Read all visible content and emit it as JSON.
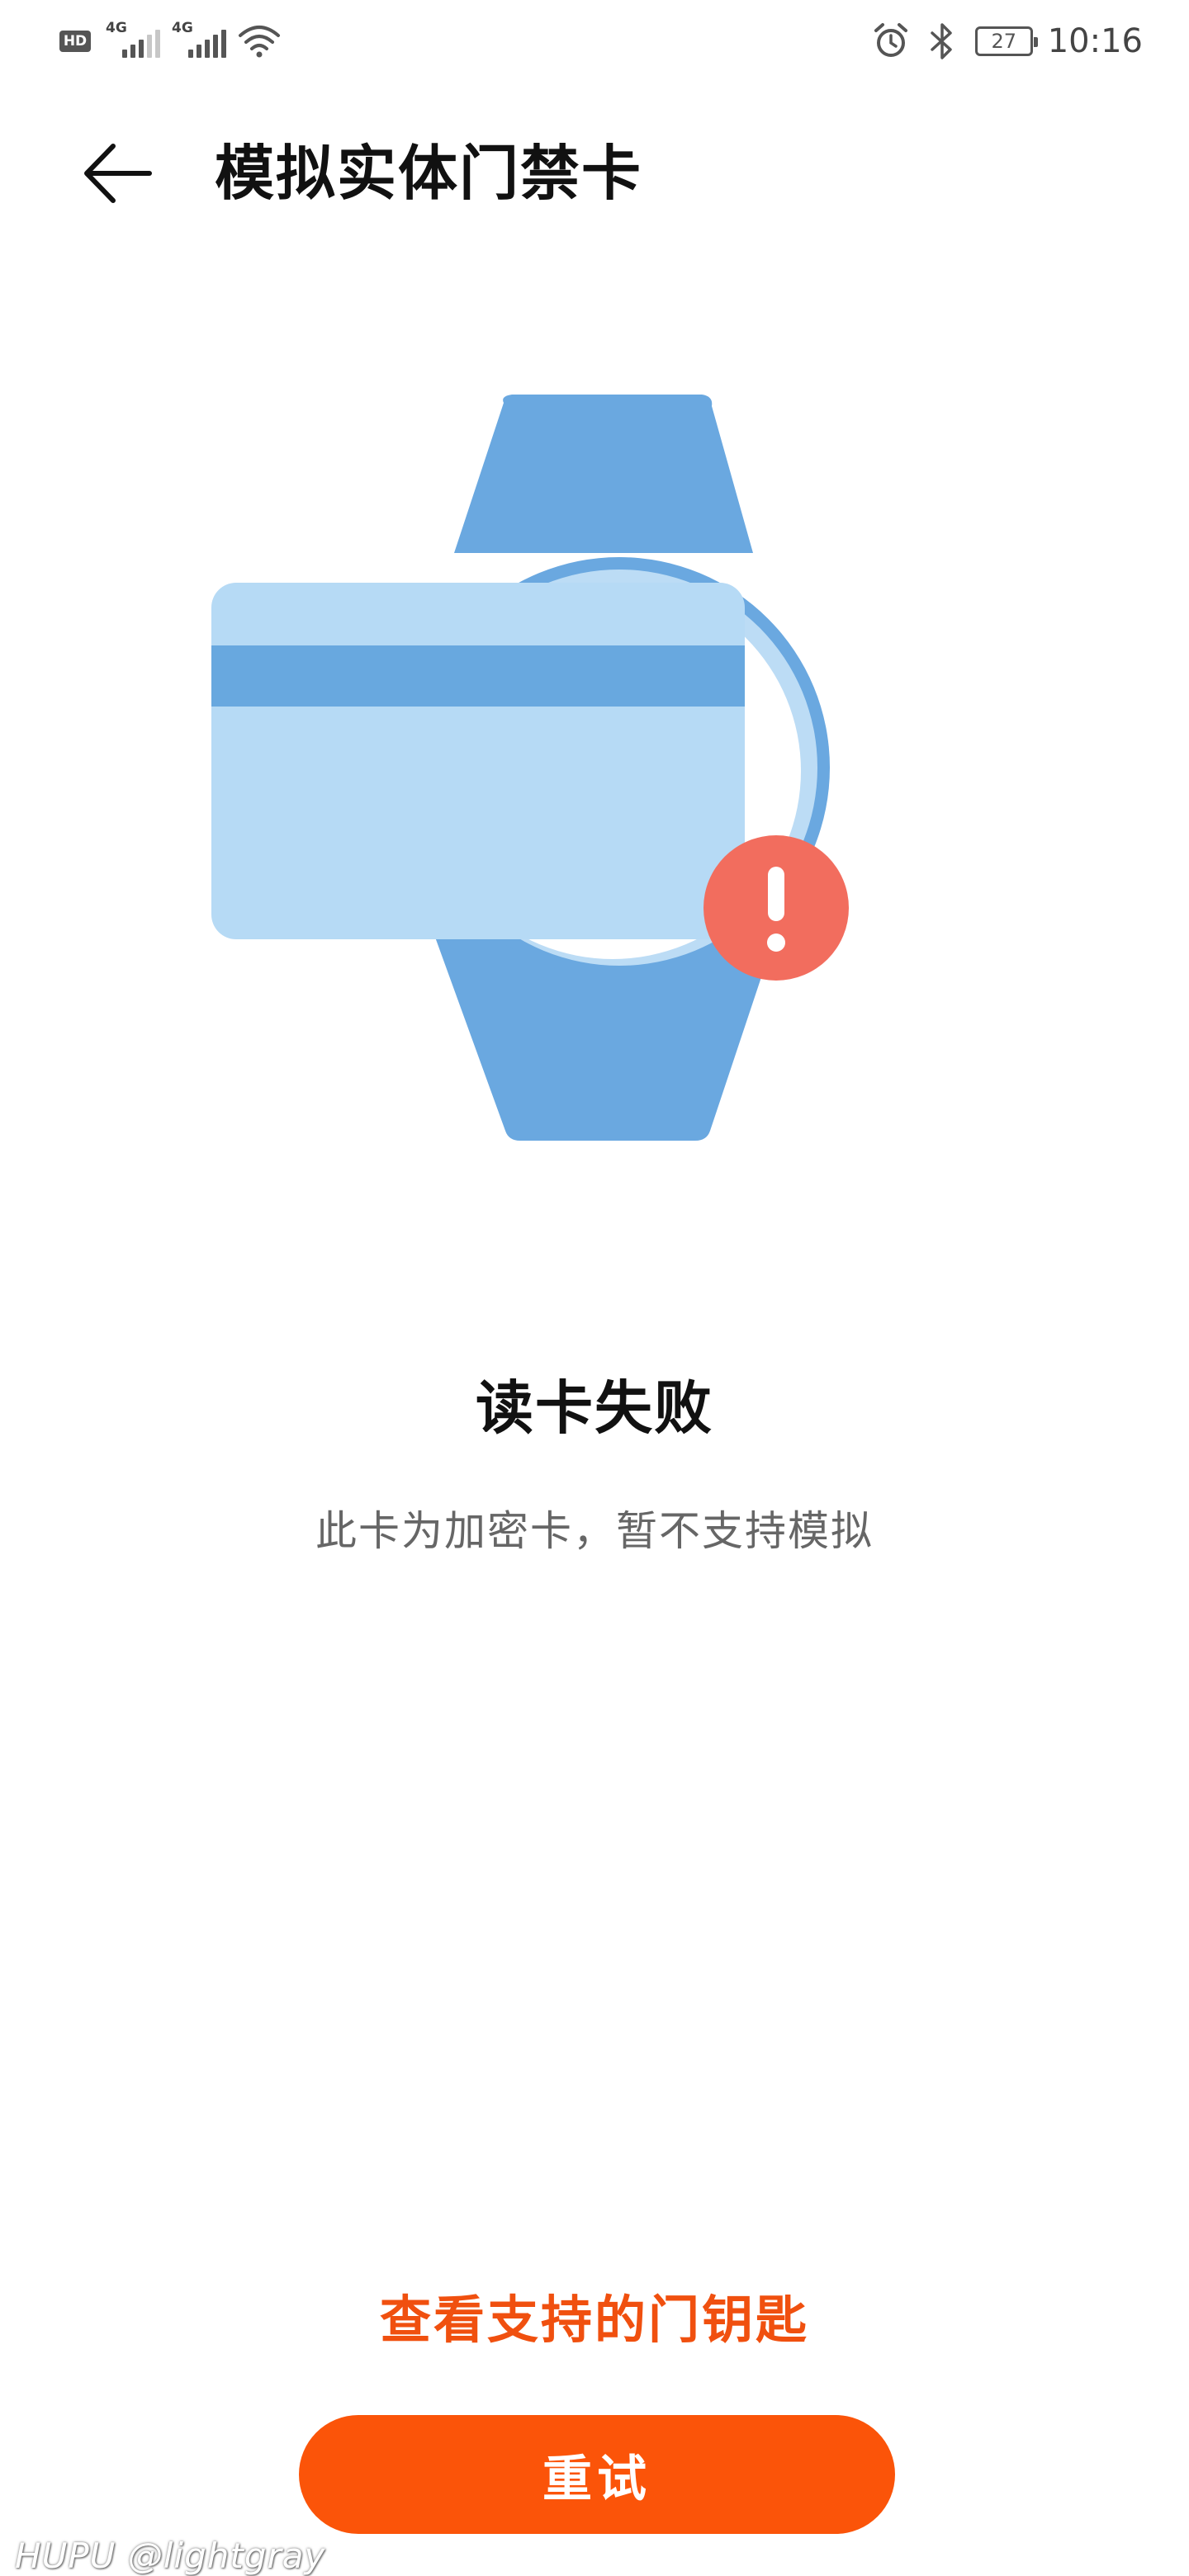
{
  "status_bar": {
    "hd_label": "HD",
    "sim1_network": "4G",
    "sim2_network": "4G",
    "battery_level": "27",
    "time": "10:16"
  },
  "header": {
    "title": "模拟实体门禁卡"
  },
  "result": {
    "title": "读卡失败",
    "description": "此卡为加密卡，暂不支持模拟"
  },
  "actions": {
    "supported_keys_link": "查看支持的门钥匙",
    "retry_label": "重试"
  },
  "watermark": {
    "text": "HUPU @lightgray"
  },
  "colors": {
    "accent": "#fb5409",
    "link": "#f0500f",
    "watch_band": "#6aa8e0",
    "card": "#b6daf5",
    "card_stripe": "#68a8df",
    "error_badge": "#f26d5e"
  },
  "icons": {
    "back": "arrow-left-icon",
    "alarm": "alarm-clock-icon",
    "bluetooth": "bluetooth-icon",
    "wifi": "wifi-icon",
    "error": "exclamation-badge-icon"
  }
}
